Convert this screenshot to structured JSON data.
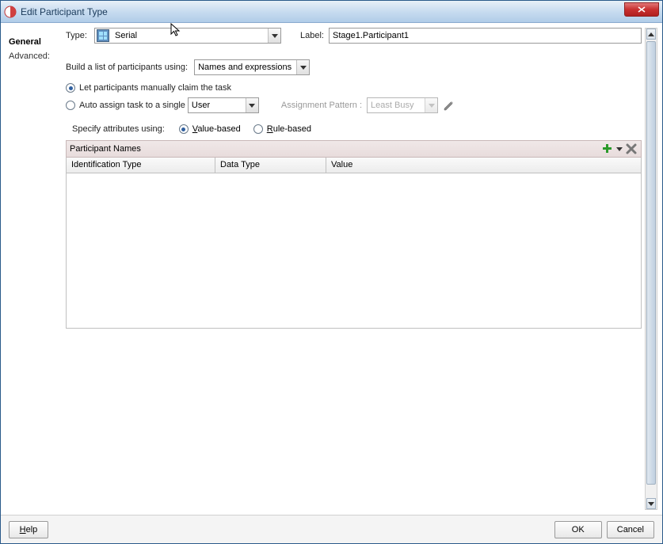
{
  "titlebar": {
    "title": "Edit Participant Type"
  },
  "sidebar": {
    "items": [
      {
        "label": "General",
        "active": true
      },
      {
        "label": "Advanced:",
        "active": false
      }
    ]
  },
  "form": {
    "type_label": "Type:",
    "type_value": "Serial",
    "label_label": "Label:",
    "label_value": "Stage1.Participant1",
    "build_label": "Build a list of participants using:",
    "build_value": "Names and expressions",
    "radio_manual": "Let participants manually claim the task",
    "radio_auto": "Auto assign task to a single",
    "auto_target": "User",
    "assignment_label": "Assignment Pattern :",
    "assignment_value": "Least Busy",
    "specify_label": "Specify attributes using:",
    "radio_value_based_prefix": "V",
    "radio_value_based_rest": "alue-based",
    "radio_rule_based_prefix": "R",
    "radio_rule_based_rest": "ule-based"
  },
  "participant_table": {
    "header": "Participant Names",
    "columns": [
      "Identification Type",
      "Data Type",
      "Value"
    ],
    "rows": []
  },
  "footer": {
    "help_prefix": "H",
    "help": "elp",
    "ok": "OK",
    "cancel": "Cancel"
  }
}
